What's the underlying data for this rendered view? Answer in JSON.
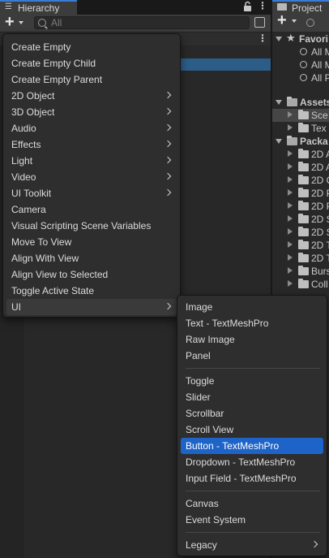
{
  "hierarchy": {
    "tab_title": "Hierarchy",
    "search_placeholder": "All"
  },
  "project": {
    "tab_title": "Project",
    "tree": [
      {
        "label": "Favori",
        "kind": "favorites",
        "expanded": true
      },
      {
        "label": "All M",
        "kind": "search"
      },
      {
        "label": "All M",
        "kind": "search"
      },
      {
        "label": "All P",
        "kind": "search"
      },
      {
        "label": "Assets",
        "kind": "folder",
        "expanded": true
      },
      {
        "label": "Sce",
        "kind": "folder",
        "selected": true
      },
      {
        "label": "Tex",
        "kind": "folder"
      },
      {
        "label": "Packa",
        "kind": "folder",
        "expanded": true
      },
      {
        "label": "2D A",
        "kind": "folder"
      },
      {
        "label": "2D A",
        "kind": "folder"
      },
      {
        "label": "2D C",
        "kind": "folder"
      },
      {
        "label": "2D P",
        "kind": "folder"
      },
      {
        "label": "2D P",
        "kind": "folder"
      },
      {
        "label": "2D S",
        "kind": "folder"
      },
      {
        "label": "2D S",
        "kind": "folder"
      },
      {
        "label": "2D T",
        "kind": "folder"
      },
      {
        "label": "2D T",
        "kind": "folder"
      },
      {
        "label": "Burs",
        "kind": "folder"
      },
      {
        "label": "Coll",
        "kind": "folder"
      }
    ]
  },
  "create_menu": {
    "items": [
      {
        "label": "Create Empty",
        "submenu": false
      },
      {
        "label": "Create Empty Child",
        "submenu": false
      },
      {
        "label": "Create Empty Parent",
        "submenu": false
      },
      {
        "label": "2D Object",
        "submenu": true
      },
      {
        "label": "3D Object",
        "submenu": true
      },
      {
        "label": "Audio",
        "submenu": true
      },
      {
        "label": "Effects",
        "submenu": true
      },
      {
        "label": "Light",
        "submenu": true
      },
      {
        "label": "Video",
        "submenu": true
      },
      {
        "label": "UI Toolkit",
        "submenu": true
      },
      {
        "label": "Camera",
        "submenu": false
      },
      {
        "label": "Visual Scripting Scene Variables",
        "submenu": false
      },
      {
        "label": "Move To View",
        "submenu": false
      },
      {
        "label": "Align With View",
        "submenu": false
      },
      {
        "label": "Align View to Selected",
        "submenu": false
      },
      {
        "label": "Toggle Active State",
        "submenu": false
      },
      {
        "label": "UI",
        "submenu": true,
        "highlighted": true
      }
    ]
  },
  "ui_submenu": {
    "groups": [
      [
        "Image",
        "Text - TextMeshPro",
        "Raw Image",
        "Panel"
      ],
      [
        "Toggle",
        "Slider",
        "Scrollbar",
        "Scroll View",
        "Button - TextMeshPro",
        "Dropdown - TextMeshPro",
        "Input Field - TextMeshPro"
      ],
      [
        "Canvas",
        "Event System"
      ],
      [
        "Legacy"
      ]
    ],
    "active_item": "Button - TextMeshPro",
    "submenu_items": [
      "Legacy"
    ]
  },
  "colors": {
    "accent": "#1e64c8",
    "selection_row": "#2c5d87",
    "menu_bg": "#2e2e2e"
  }
}
